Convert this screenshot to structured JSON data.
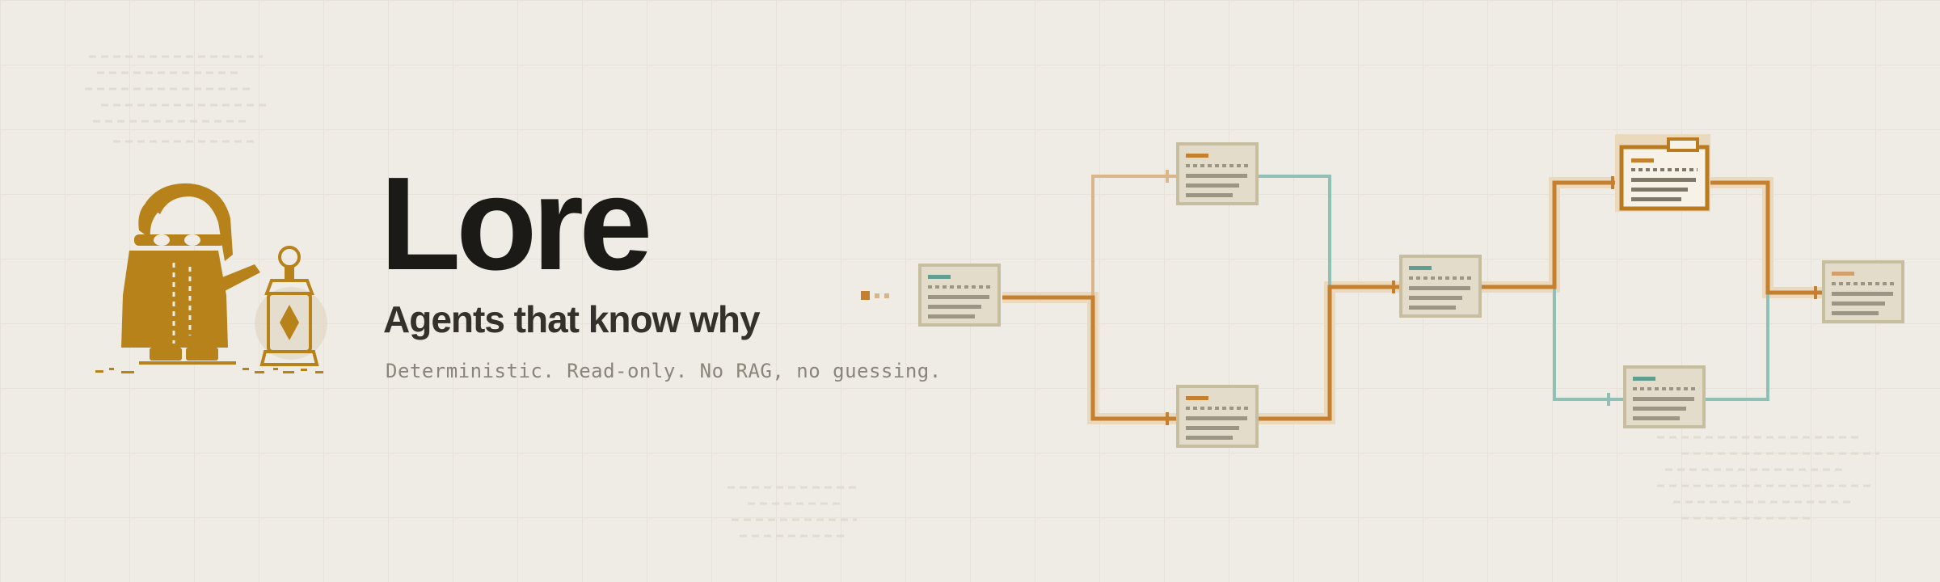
{
  "title": "Lore",
  "subtitle": "Agents that know why",
  "tagline": "Deterministic. Read-only. No RAG, no guessing.",
  "colors": {
    "background": "#efece5",
    "accent_orange": "#c4802f",
    "accent_teal": "#8fbfb5",
    "card": "#e3dccb",
    "card_border": "#c7bd9f",
    "mascot": "#b7821a",
    "text_dark": "#1b1a17",
    "text_muted": "#8a857a"
  },
  "icons": [
    "wizard-mascot",
    "lantern-icon",
    "document-card-icon",
    "folder-document-icon"
  ]
}
